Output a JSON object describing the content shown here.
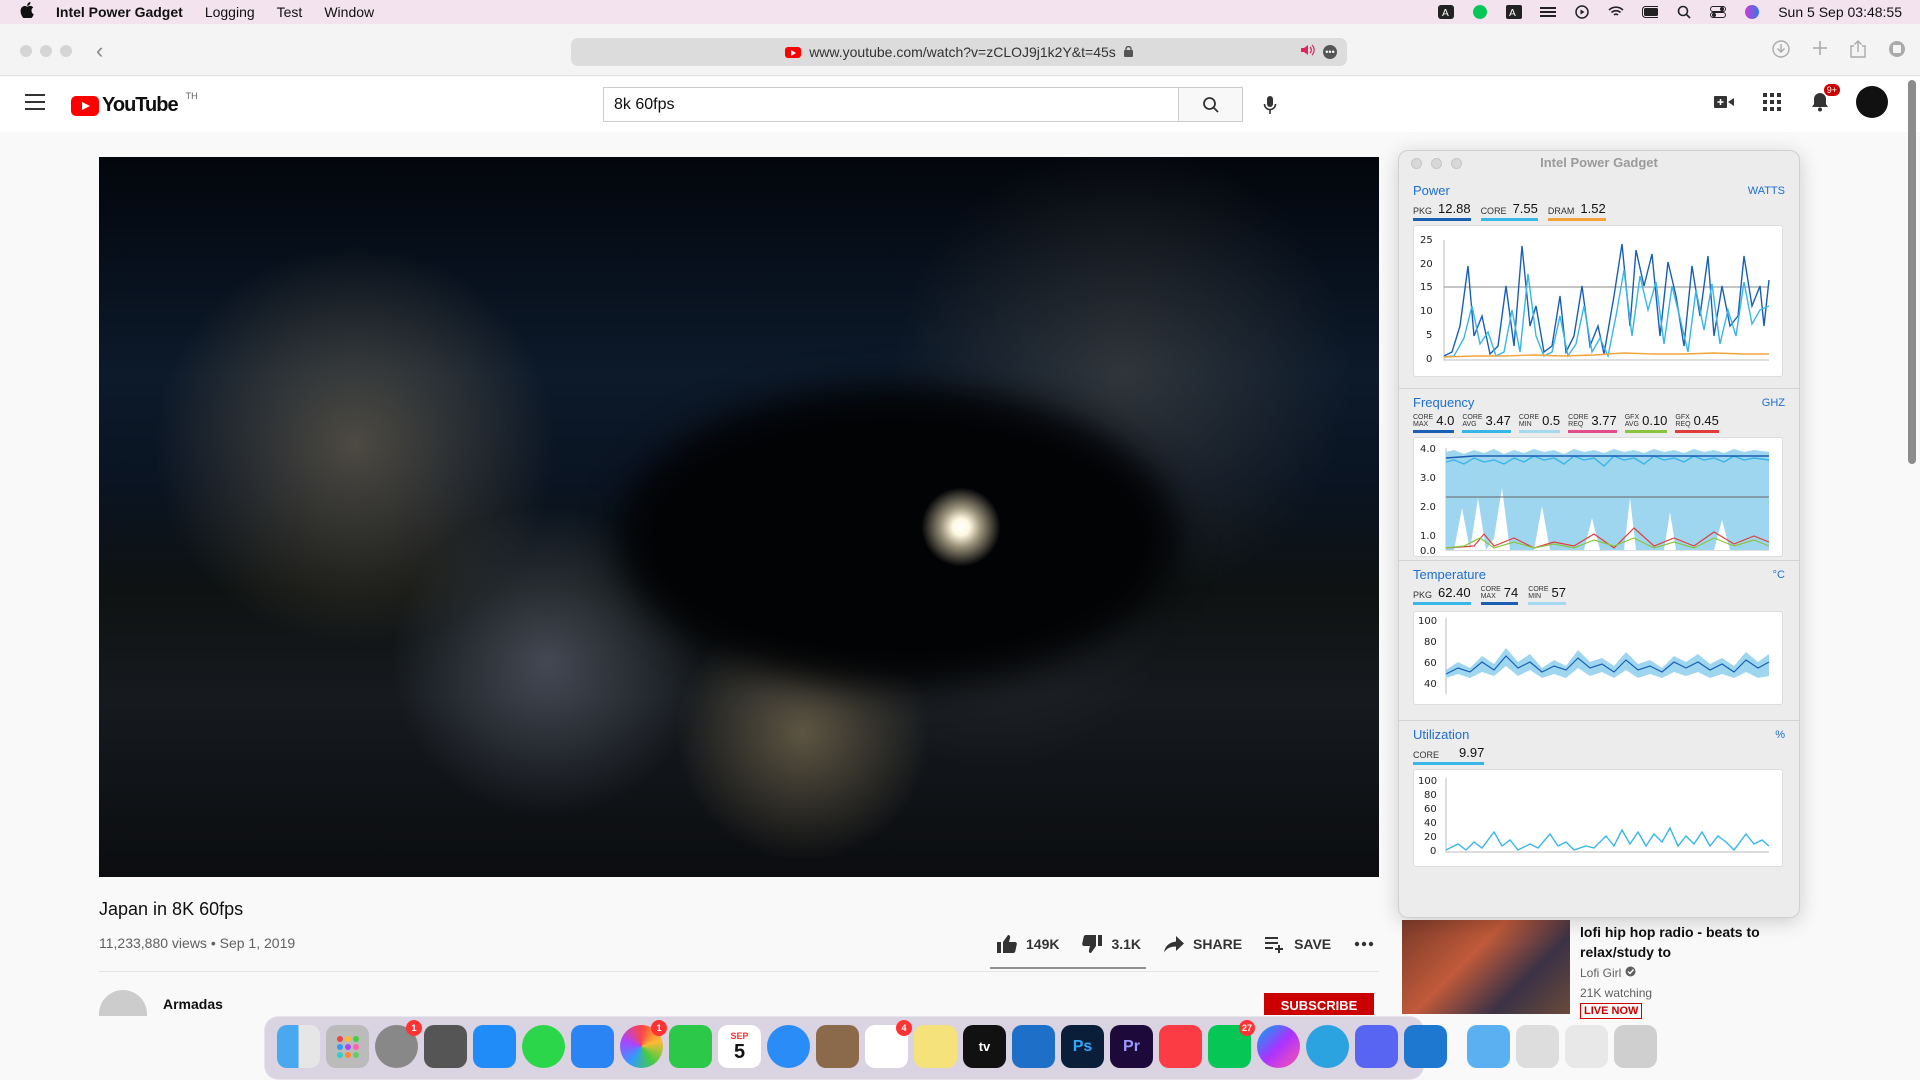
{
  "menubar": {
    "app": "Intel Power Gadget",
    "items": [
      "Logging",
      "Test",
      "Window"
    ],
    "datetime": "Sun 5 Sep  03:48:55"
  },
  "safari": {
    "url": "www.youtube.com/watch?v=zCLOJ9j1k2Y&t=45s"
  },
  "youtube": {
    "logo": "YouTube",
    "country": "TH",
    "search_value": "8k 60fps",
    "notification_badge": "9+",
    "video_title": "Japan in 8K 60fps",
    "views": "11,233,880 views",
    "date": "Sep 1, 2019",
    "likes": "149K",
    "dislikes": "3.1K",
    "share": "SHARE",
    "save": "SAVE",
    "channel": "Armadas",
    "subscribe": "SUBSCRIBE",
    "recommended": {
      "title": "lofi hip hop radio - beats to relax/study to",
      "channel": "Lofi Girl",
      "watching": "21K watching",
      "live": "LIVE NOW"
    }
  },
  "gadget": {
    "title": "Intel Power Gadget",
    "power": {
      "heading": "Power",
      "unit": "WATTS",
      "pkg_label": "PKG",
      "pkg": "12.88",
      "core_label": "CORE",
      "core": "7.55",
      "dram_label": "DRAM",
      "dram": "1.52",
      "ticks": [
        "25",
        "20",
        "15",
        "10",
        "5",
        "0"
      ]
    },
    "frequency": {
      "heading": "Frequency",
      "unit": "GHZ",
      "core_max": "4.0",
      "core_avg": "3.47",
      "core_min": "0.5",
      "core_req": "3.77",
      "gfx_avg": "0.10",
      "gfx_req": "0.45",
      "lbl_core": "CORE",
      "lbl_gfx": "GFX",
      "lbl_max": "MAX",
      "lbl_avg": "AVG",
      "lbl_min": "MIN",
      "lbl_req": "REQ",
      "ticks": [
        "4.0",
        "3.0",
        "2.0",
        "1.0",
        "0.0"
      ]
    },
    "temperature": {
      "heading": "Temperature",
      "unit": "°C",
      "pkg_label": "PKG",
      "pkg": "62.40",
      "core_max": "74",
      "core_min": "57",
      "ticks": [
        "100",
        "80",
        "60",
        "40"
      ]
    },
    "utilization": {
      "heading": "Utilization",
      "unit": "%",
      "core_label": "CORE",
      "core": "9.97",
      "ticks": [
        "100",
        "80",
        "60",
        "40",
        "20",
        "0"
      ]
    }
  },
  "dock": {
    "date_month": "SEP",
    "date_day": "5",
    "badges": {
      "settings": "1",
      "photos": "1",
      "reminders": "4",
      "line": "27"
    },
    "letters": {
      "ps": "Ps",
      "pr": "Pr",
      "tv": "tv"
    }
  },
  "colors": {
    "youtube_red": "#ff0000",
    "gadget_blue": "#1d6fd0",
    "core_cyan": "#38b6e8",
    "dram_orange": "#f2a43b"
  }
}
